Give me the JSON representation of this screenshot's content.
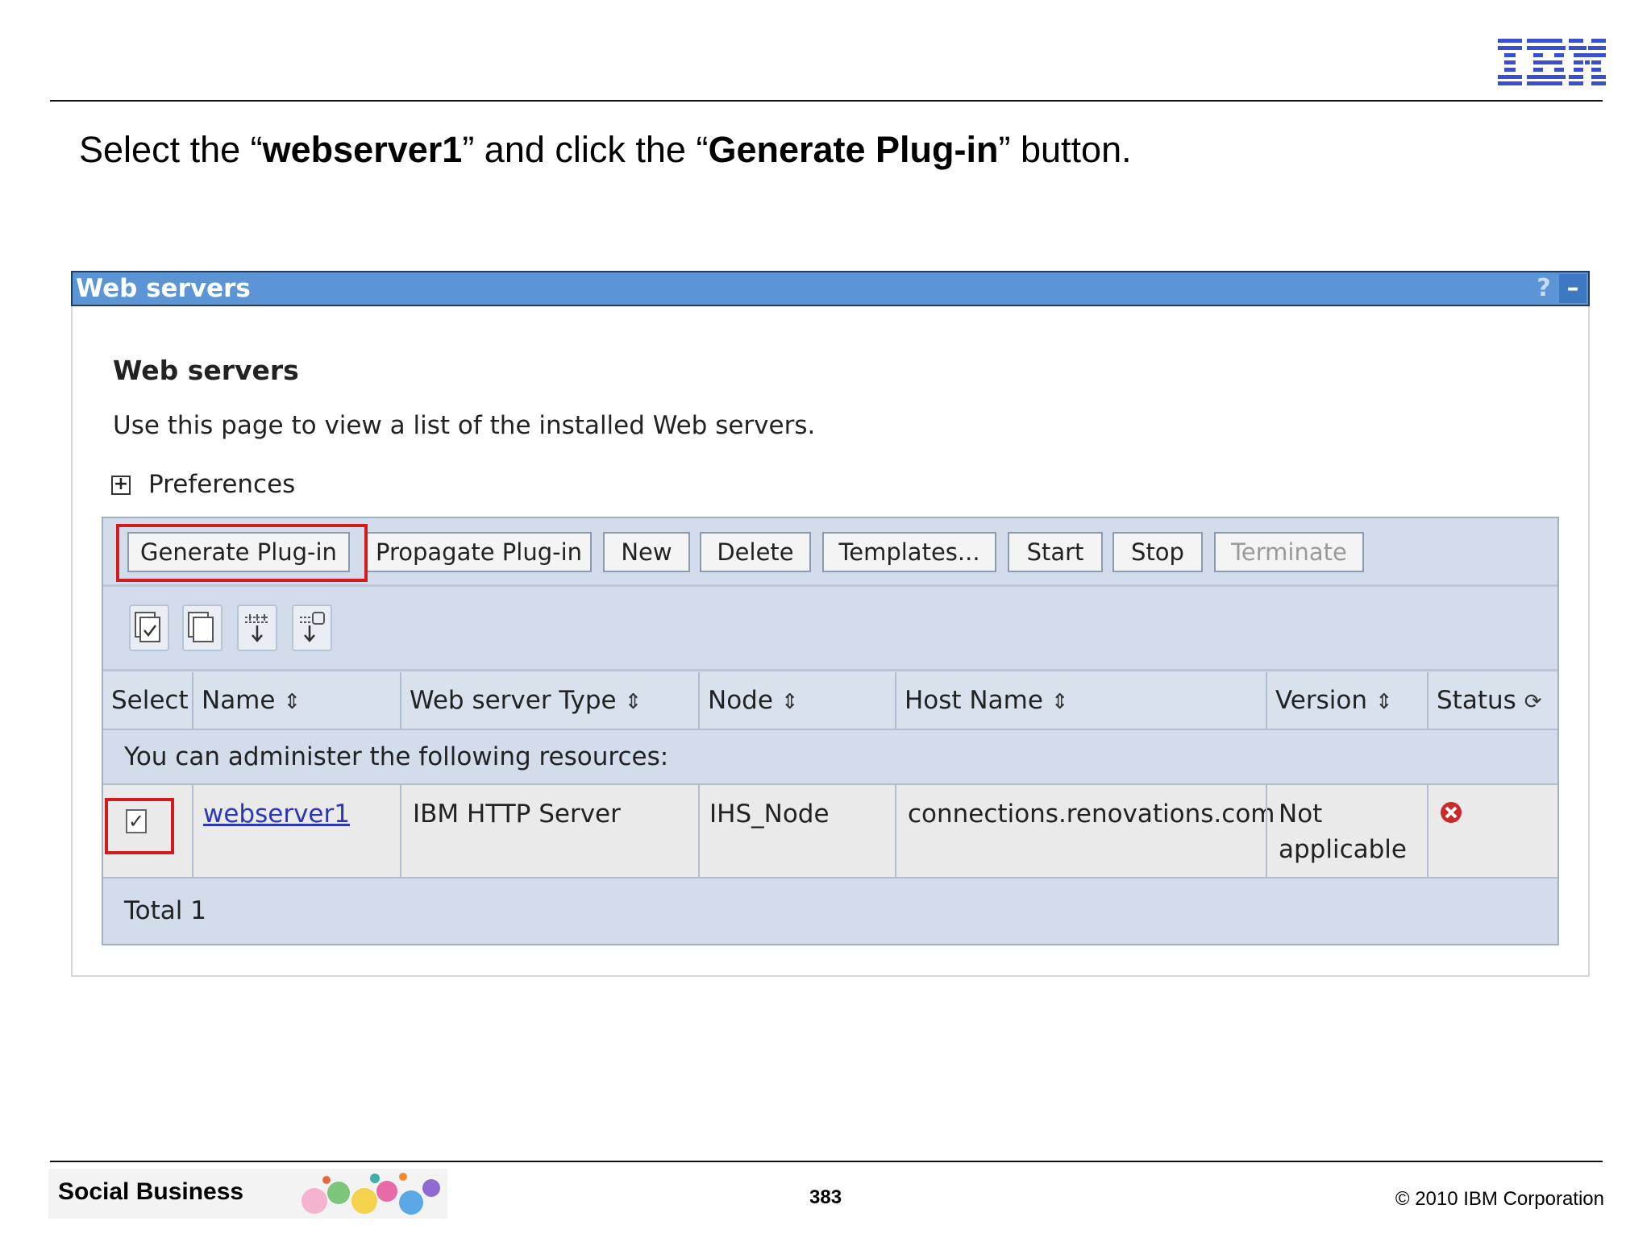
{
  "instruction": {
    "part1": "Select the “",
    "bold1": "webserver1",
    "part2": "” and click the “",
    "bold2": "Generate Plug-in",
    "part3": "” button."
  },
  "portlet": {
    "title": "Web servers",
    "help": "?",
    "minimize": "–"
  },
  "page": {
    "title": "Web servers",
    "description": "Use this page to view a list of the installed Web servers.",
    "preferences_label": "Preferences",
    "preferences_icon": "plus-box-icon"
  },
  "buttons": {
    "generate": "Generate Plug-in",
    "propagate": "Propagate Plug-in",
    "new": "New",
    "delete": "Delete",
    "templates": "Templates...",
    "start": "Start",
    "stop": "Stop",
    "terminate": "Terminate"
  },
  "table": {
    "columns": {
      "select": "Select",
      "name": "Name",
      "type": "Web server Type",
      "node": "Node",
      "host": "Host Name",
      "version": "Version",
      "status": "Status"
    },
    "resources_text": "You can administer the following resources:",
    "row": {
      "name": "webserver1",
      "type": "IBM HTTP Server",
      "node": "IHS_Node",
      "host": "connections.renovations.com",
      "version_line1": "Not",
      "version_line2": "applicable",
      "checked": true,
      "status_icon": "stopped-x-icon"
    },
    "total": "Total 1"
  },
  "footer": {
    "brand": "Social Business",
    "page_number": "383",
    "copyright": "© 2010 IBM Corporation"
  },
  "colors": {
    "title_bar": "#5b95d6",
    "highlight": "#d01c1c",
    "table_bg": "#d3dcea",
    "link": "#2a37b8"
  }
}
